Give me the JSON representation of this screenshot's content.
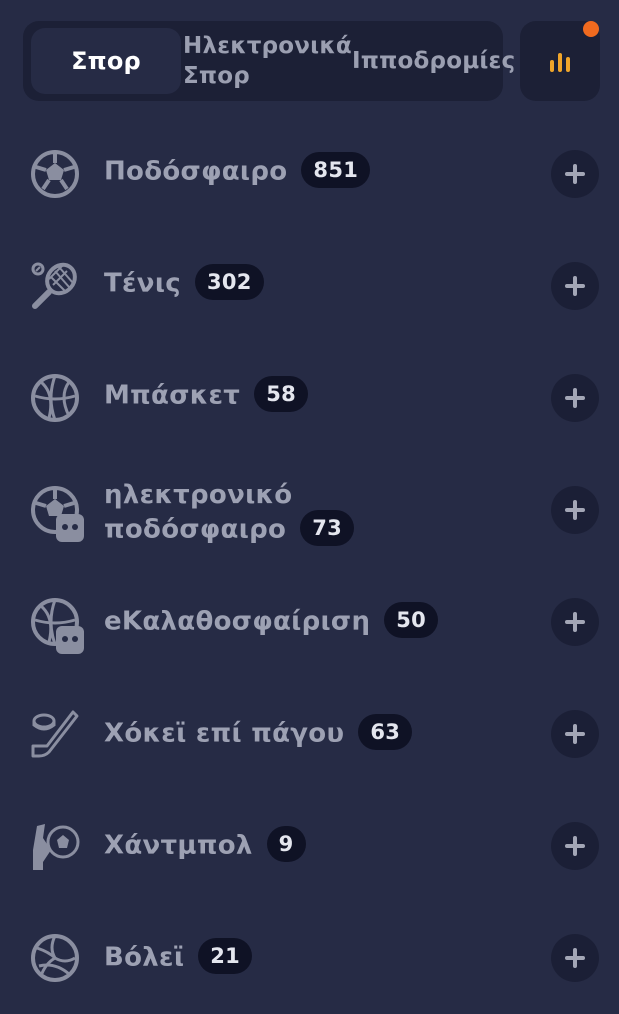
{
  "tabs": [
    {
      "label": "Σπορ",
      "active": true
    },
    {
      "label": "Ηλεκτρονικά\nΣπορ",
      "active": false
    },
    {
      "label": "Ιπποδρομίες",
      "active": false
    }
  ],
  "stats_button": {
    "icon": "bar-chart-icon",
    "notification": true
  },
  "colors": {
    "background": "#262b45",
    "panel": "#1c2036",
    "accent": "#f0a52a",
    "notification": "#f06a1f"
  },
  "sports": [
    {
      "name": "Ποδόσφαιρο",
      "count": "851",
      "icon": "soccer-ball-icon"
    },
    {
      "name": "Τένις",
      "count": "302",
      "icon": "tennis-racket-icon"
    },
    {
      "name": "Μπάσκετ",
      "count": "58",
      "icon": "basketball-icon"
    },
    {
      "name": "ηλεκτρονικό",
      "name2": "ποδόσφαιρο",
      "count": "73",
      "icon": "esoccer-icon"
    },
    {
      "name": "eΚαλαθοσφαίριση",
      "count": "50",
      "icon": "ebasketball-icon"
    },
    {
      "name": "Χόκεϊ επί πάγου",
      "count": "63",
      "icon": "ice-hockey-icon"
    },
    {
      "name": "Χάντμπολ",
      "count": "9",
      "icon": "handball-icon"
    },
    {
      "name": "Βόλεϊ",
      "count": "21",
      "icon": "volleyball-icon"
    }
  ]
}
